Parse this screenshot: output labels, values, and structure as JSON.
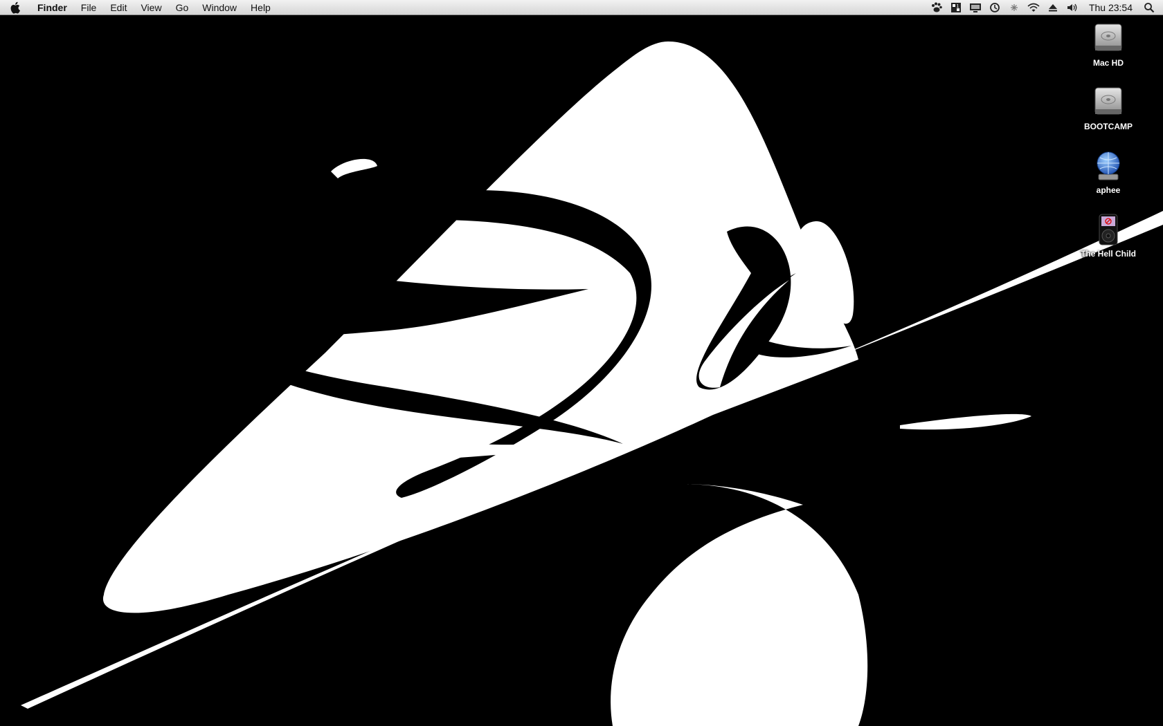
{
  "menubar": {
    "app_name": "Finder",
    "items": [
      "File",
      "Edit",
      "View",
      "Go",
      "Window",
      "Help"
    ],
    "status_icons": [
      "paw-icon",
      "spaces-icon",
      "display-icon",
      "time-machine-icon",
      "bluetooth-icon",
      "wifi-icon",
      "eject-icon",
      "volume-icon"
    ],
    "clock": "Thu 23:54",
    "search_icon": "spotlight-icon"
  },
  "desktop": {
    "icons": [
      {
        "label": "Mac HD",
        "kind": "hard-drive-icon"
      },
      {
        "label": "BOOTCAMP",
        "kind": "hard-drive-icon"
      },
      {
        "label": "aphee",
        "kind": "network-globe-icon"
      },
      {
        "label": "The Hell Child",
        "kind": "ipod-icon"
      }
    ]
  },
  "colors": {
    "wallpaper_background": "#000000",
    "wallpaper_foreground": "#ffffff",
    "menubar_text": "#111111"
  }
}
